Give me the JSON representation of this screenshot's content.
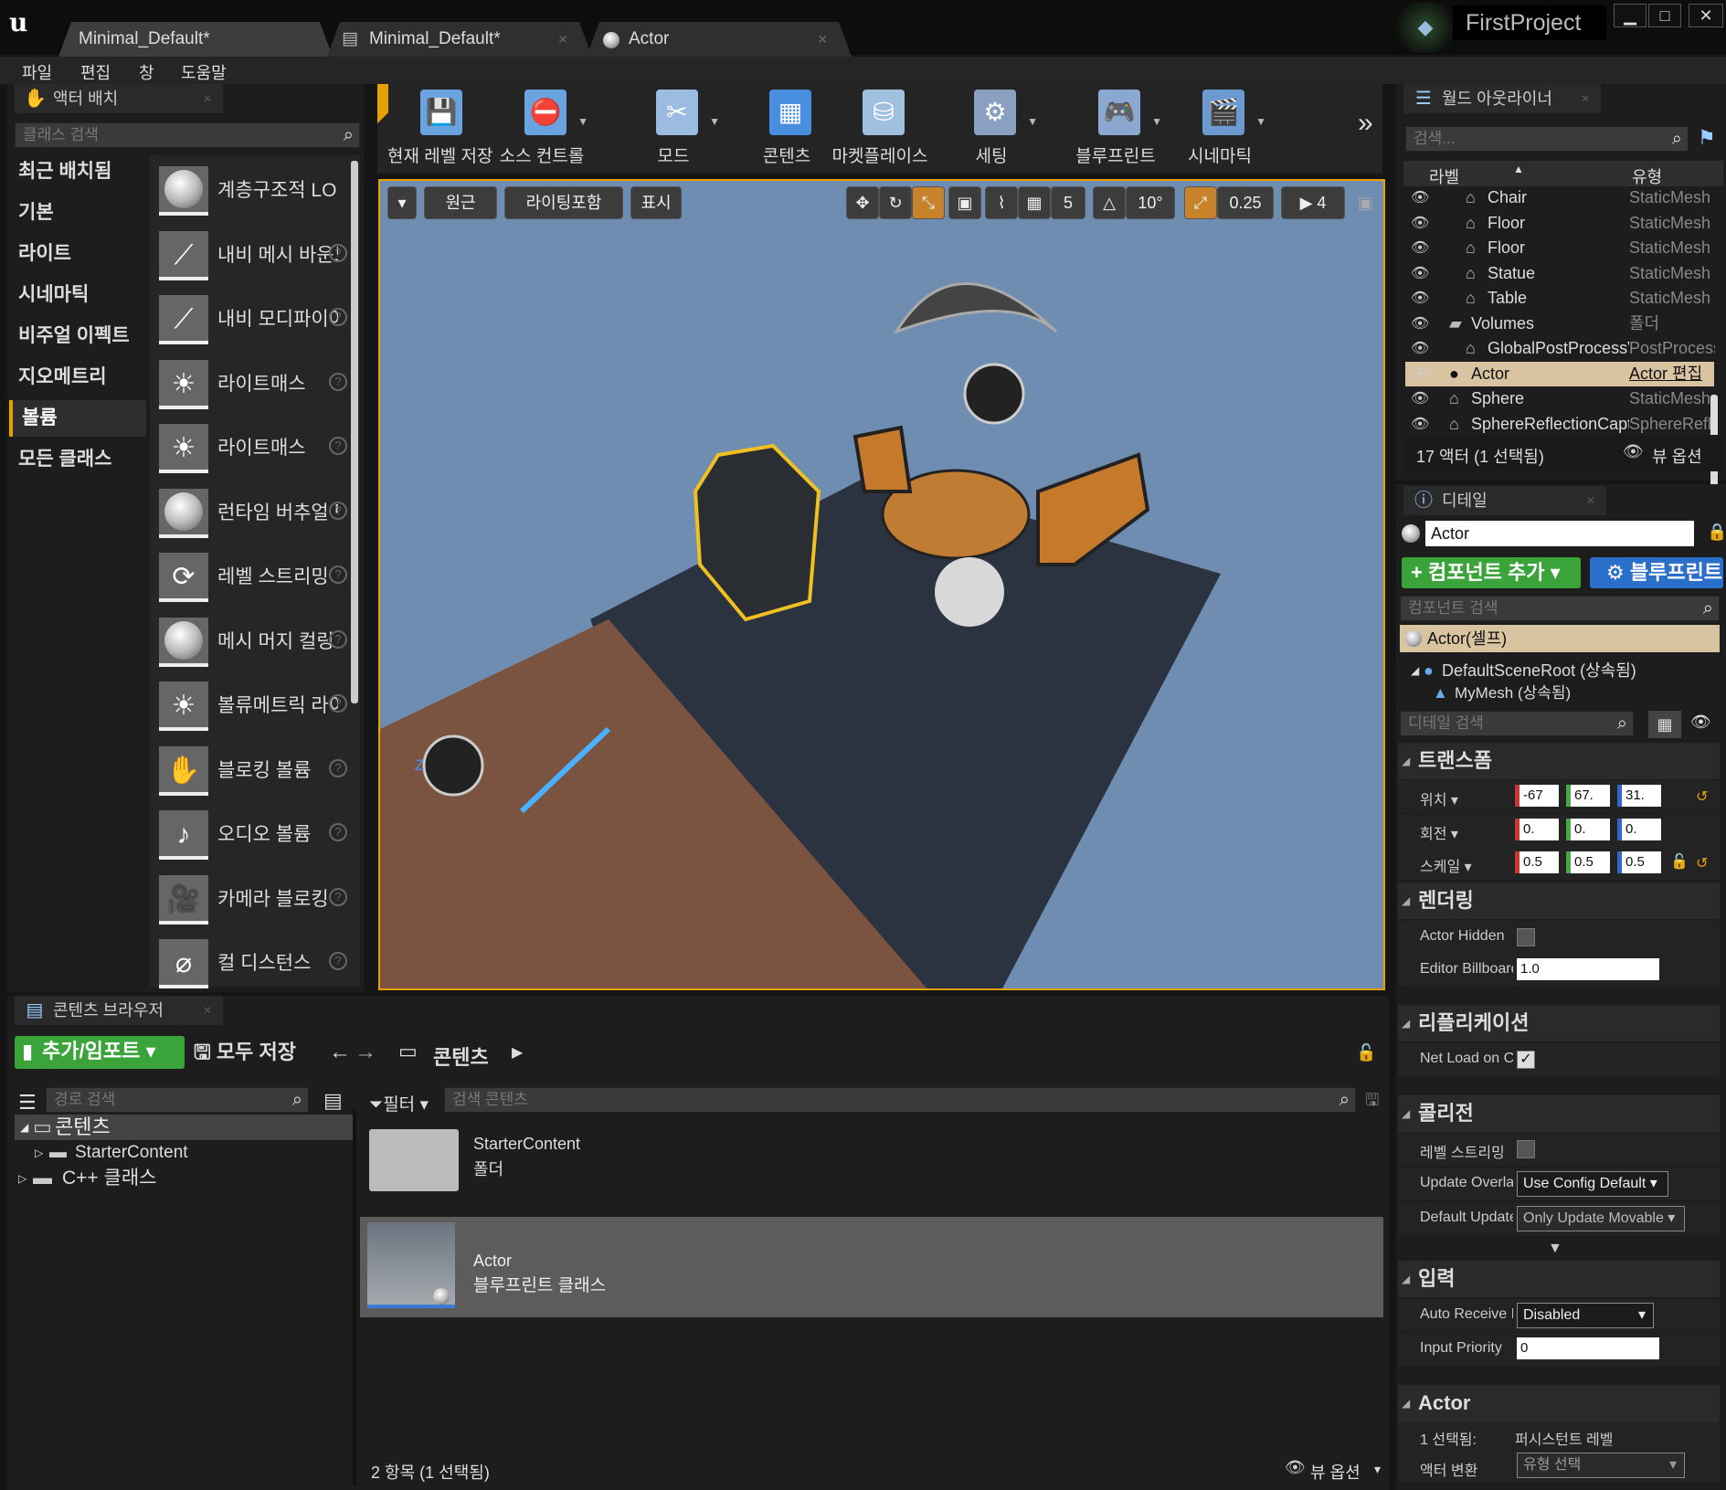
{
  "window": {
    "tabs": [
      {
        "label": "Minimal_Default*"
      },
      {
        "label": "Minimal_Default*"
      },
      {
        "label": "Actor"
      }
    ],
    "project": "FirstProject",
    "menu": [
      "파일",
      "편집",
      "창",
      "도움말"
    ]
  },
  "place_actors": {
    "tab": "액터 배치",
    "search_placeholder": "클래스 검색",
    "categories": [
      "최근 배치됨",
      "기본",
      "라이트",
      "시네마틱",
      "비주얼 이펙트",
      "지오메트리",
      "볼륨",
      "모든 클래스"
    ],
    "selected_category": "볼륨",
    "items": [
      "계층구조적 LOD",
      "내비 메시 바운드",
      "내비 모디파이어",
      "라이트매스",
      "라이트매스",
      "런타임 버추얼 텍스처",
      "레벨 스트리밍",
      "메시 머지 컬링",
      "볼류메트릭 라이트",
      "블로킹 볼륨",
      "오디오 볼륨",
      "카메라 블로킹",
      "컬 디스턴스"
    ]
  },
  "toolbar": {
    "buttons": [
      {
        "label": "현재 레벨 저장",
        "icon": "save-icon"
      },
      {
        "label": "소스 컨트롤",
        "icon": "source-control-icon"
      },
      {
        "label": "모드",
        "icon": "modes-icon"
      },
      {
        "label": "콘텐츠",
        "icon": "content-icon"
      },
      {
        "label": "마켓플레이스",
        "icon": "marketplace-icon"
      },
      {
        "label": "세팅",
        "icon": "settings-icon"
      },
      {
        "label": "블루프린트",
        "icon": "blueprint-icon"
      },
      {
        "label": "시네마틱",
        "icon": "cinematic-icon"
      }
    ]
  },
  "viewport": {
    "perspective": "원근",
    "lighting": "라이팅포함",
    "show": "표시",
    "grid_snap": "5",
    "rot_snap": "10°",
    "scale_snap": "0.25",
    "cam_speed": "4",
    "axis_z": "Z"
  },
  "outliner": {
    "tab": "월드 아웃라이너",
    "search_placeholder": "검색...",
    "col_label": "라벨",
    "col_type": "유형",
    "rows": [
      {
        "name": "Chair",
        "type": "StaticMesh"
      },
      {
        "name": "Floor",
        "type": "StaticMesh"
      },
      {
        "name": "Floor",
        "type": "StaticMesh"
      },
      {
        "name": "Statue",
        "type": "StaticMesh"
      },
      {
        "name": "Table",
        "type": "StaticMesh"
      },
      {
        "name": "Volumes",
        "type": "폴더"
      },
      {
        "name": "GlobalPostProcessVolume",
        "type": "PostProcess"
      },
      {
        "name": "Actor",
        "type": "Actor 편집"
      },
      {
        "name": "Sphere",
        "type": "StaticMesh"
      },
      {
        "name": "SphereReflectionCapture",
        "type": "SphereRefl"
      }
    ],
    "status": "17 액터 (1 선택됨)",
    "view_options": "뷰 옵션"
  },
  "details": {
    "tab": "디테일",
    "actor_name": "Actor",
    "add_component": "컴포넌트 추가",
    "blueprint": "블루프린트",
    "component_search": "컴포넌트 검색",
    "components": [
      "Actor(셀프)",
      "DefaultSceneRoot (상속됨)",
      "MyMesh (상속됨)"
    ],
    "detail_search": "디테일 검색",
    "transform": {
      "title": "트랜스폼",
      "location_label": "위치",
      "location": [
        "-67",
        "67.",
        "31."
      ],
      "rotation_label": "회전",
      "rotation": [
        "0.",
        "0.",
        "0."
      ],
      "scale_label": "스케일",
      "scale": [
        "0.5",
        "0.5",
        "0.5"
      ]
    },
    "rendering": {
      "title": "렌더링",
      "hidden_label": "Actor Hidden",
      "billboard_label": "Editor Billboard",
      "billboard_value": "1.0"
    },
    "replication": {
      "title": "리플리케이션",
      "net_load_label": "Net Load on Client"
    },
    "collision": {
      "title": "콜리전",
      "level_streaming_label": "레벨 스트리밍",
      "update_overlaps_label": "Update Overlaps",
      "update_overlaps_value": "Use Config Default",
      "default_update_label": "Default Update",
      "default_update_value": "Only Update Movable"
    },
    "input": {
      "title": "입력",
      "auto_receive_label": "Auto Receive Input",
      "auto_receive_value": "Disabled",
      "priority_label": "Input Priority",
      "priority_value": "0"
    },
    "actor": {
      "title": "Actor",
      "selected_label": "1 선택됨:",
      "selected_value": "퍼시스턴트 레벨",
      "convert_label": "액터 변환",
      "convert_value": "유형 선택"
    }
  },
  "content_browser": {
    "tab": "콘텐츠 브라우저",
    "add_import": "추가/임포트",
    "save_all": "모두 저장",
    "path_root": "콘텐츠",
    "path_search": "경로 검색",
    "filter": "필터",
    "content_search": "검색 콘텐츠",
    "tree": [
      "콘텐츠",
      "StarterContent",
      "C++ 클래스"
    ],
    "assets": [
      {
        "name": "StarterContent",
        "type": "폴더"
      },
      {
        "name": "Actor",
        "type": "블루프린트 클래스"
      }
    ],
    "status": "2 항목 (1 선택됨)",
    "view_options": "뷰 옵션"
  },
  "colors": {
    "accent": "#e6a000",
    "selection": "#d9c4a2",
    "green_button": "#3aa43a",
    "blue_button": "#2a6fc9"
  }
}
